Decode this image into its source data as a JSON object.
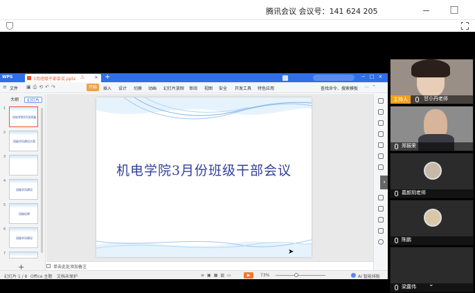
{
  "meeting": {
    "title": "腾讯会议 会议号：141 624 205"
  },
  "wps": {
    "brand": "WPS",
    "doc_tab": "3月班级干部会议.pptx",
    "ribbon": {
      "file": "文件",
      "start": "开始",
      "items": [
        "插入",
        "设计",
        "切换",
        "动画",
        "幻灯片放映",
        "审阅",
        "视图",
        "安全",
        "开发工具",
        "特色应用"
      ],
      "search": "查找命令、搜索模板"
    },
    "sidebar": {
      "tab_outline": "大纲",
      "tab_slides": "幻灯片",
      "thumbnails": [
        {
          "num": "1",
          "text": "机电学院3月份班级干部会议"
        },
        {
          "num": "2",
          "text": "班级学风建设方案"
        },
        {
          "num": "3",
          "text": ""
        },
        {
          "num": "4",
          "text": "班级学风建设"
        },
        {
          "num": "5",
          "text": "班级纪律"
        },
        {
          "num": "6",
          "text": "班级学风建设"
        },
        {
          "num": "7",
          "text": ""
        }
      ],
      "add": "+"
    },
    "slide": {
      "title": "机电学院3月份班级干部会议"
    },
    "notes_label": "单击此处添加备注",
    "status": {
      "page": "幻灯片 1 / 8",
      "theme": "Office 主题",
      "protect": "文档未保护",
      "zoom": "73%",
      "ai": "AI 智能排版"
    }
  },
  "participants": [
    {
      "name": "甘小丹老师",
      "host_label": "主持人",
      "type": "video"
    },
    {
      "name": "郑振荣",
      "type": "video"
    },
    {
      "name": "葛颜玥老师",
      "type": "avatar"
    },
    {
      "name": "陈鹏",
      "type": "avatar"
    },
    {
      "name": "梁露伟",
      "type": "empty"
    }
  ]
}
